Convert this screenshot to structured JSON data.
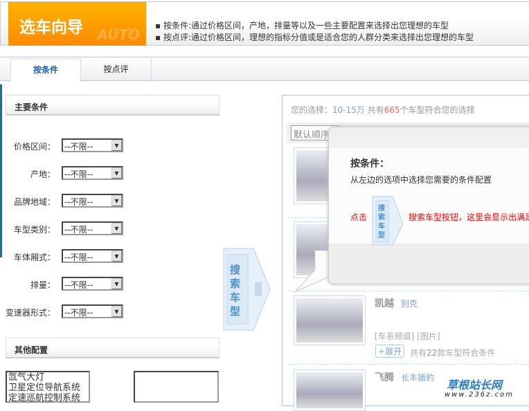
{
  "header": {
    "title": "选车向导",
    "watermark": "AUTO",
    "intro": [
      "按条件:通过价格区间，产地，排量等以及一些主要配置来选择出您理想的车型",
      "按点评:通过价格区间，理想的指标分值或是适合您的人群分类来选择出您理想的车型"
    ]
  },
  "tabs": [
    {
      "label": "按条件",
      "active": true
    },
    {
      "label": "按点评",
      "active": false
    }
  ],
  "main_conditions": {
    "title": "主要条件",
    "rows": [
      {
        "label": "价格区间：",
        "value": "--不限--"
      },
      {
        "label": "产地：",
        "value": "--不限--"
      },
      {
        "label": "品牌地域：",
        "value": "--不限--"
      },
      {
        "label": "车型类别：",
        "value": "--不限--"
      },
      {
        "label": "车体厢式：",
        "value": "--不限--"
      },
      {
        "label": "排量：",
        "value": "--不限--"
      },
      {
        "label": "变速器形式：",
        "value": "--不限--"
      }
    ]
  },
  "search_button": {
    "label": "搜索车型"
  },
  "other_config": {
    "title": "其他配置",
    "options": [
      "氙气大灯",
      "卫星定位导航系统",
      "定速巡航控制系统"
    ]
  },
  "results": {
    "prefix": "您的选择：",
    "range": "10-15万",
    "count_pre": "共有",
    "count": "665",
    "count_post": "个车型符合您的选择",
    "sort": "默认顺序",
    "cars": [
      {
        "name": "凯越",
        "brand": "别克",
        "links": "[车系频道] [图片]",
        "expand": "展开",
        "match_pre": "共有",
        "match_count": "22",
        "match_post": "款车型符合条件"
      },
      {
        "name": "飞腾",
        "brand": "长丰猎豹"
      }
    ]
  },
  "popup": {
    "title": "按条件：",
    "desc": "从左边的选项中选择您需要的条件配置",
    "click": "点击",
    "button": "搜索车型",
    "tail": "搜索车型按钮，这里会显示出满足"
  },
  "watermark": {
    "name": "草根站长网",
    "url": "www.236z.com"
  },
  "colors": {
    "orange": "#ff9900",
    "link": "#7ba3d6",
    "highlight": "#ff6666",
    "tab_active": "#1a5fb4"
  }
}
